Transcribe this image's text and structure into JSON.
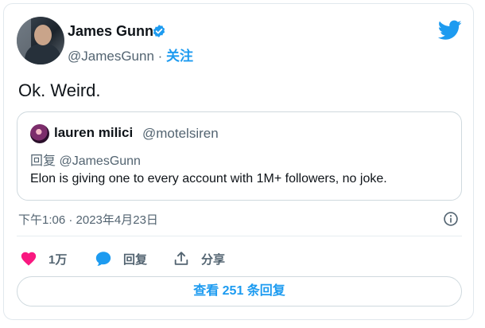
{
  "author": {
    "name": "James Gunn",
    "handle": "@JamesGunn",
    "separator": " · ",
    "follow_label": "关注"
  },
  "tweet": {
    "text": "Ok. Weird.",
    "timestamp": "下午1:06 · 2023年4月23日"
  },
  "quote": {
    "name": "lauren milici",
    "handle": "@motelsiren",
    "reply_to": "回复 @JamesGunn",
    "text": "Elon is giving one to every account with 1M+ followers, no joke."
  },
  "actions": {
    "like_count": "1万",
    "reply_label": "回复",
    "share_label": "分享"
  },
  "replies_button": "查看 251 条回复",
  "colors": {
    "accent": "#1d9bf0",
    "like": "#f91880",
    "text": "#0f1419",
    "muted": "#536471"
  }
}
